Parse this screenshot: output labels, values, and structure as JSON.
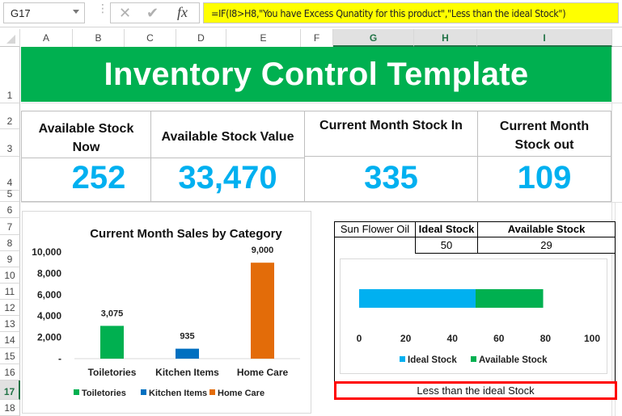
{
  "formula_bar": {
    "name_box": "G17",
    "cancel_icon": "x-icon",
    "enter_icon": "check-icon",
    "function_icon": "fx-icon",
    "formula": "=IF(I8>H8,\"You have Excess Qunatity for this product\",\"Less than the ideal Stock\")"
  },
  "columns": [
    "A",
    "B",
    "C",
    "D",
    "E",
    "F",
    "G",
    "H",
    "I"
  ],
  "selected_columns": [
    "G",
    "H",
    "I"
  ],
  "rows": [
    "1",
    "2",
    "3",
    "4",
    "5",
    "6",
    "7",
    "8",
    "9",
    "10",
    "11",
    "12",
    "13",
    "14",
    "15",
    "16",
    "17",
    "18"
  ],
  "selected_row": "17",
  "title": "Inventory Control Template",
  "colors": {
    "banner": "#00b050",
    "kpi_value": "#00b0f0",
    "toiletories": "#00b050",
    "kitchen_items": "#0070c0",
    "home_care": "#e36c09",
    "ideal_stock": "#00b0f0",
    "available_stock": "#00b050",
    "status_border": "#ff0000"
  },
  "kpis": [
    {
      "label_line1": "Available Stock",
      "label_line2": "Now",
      "value": "252"
    },
    {
      "label_line1": "Available Stock Value",
      "label_line2": "",
      "value": "33,470"
    },
    {
      "label_line1": "Current Month Stock In",
      "label_line2": "",
      "value": "335"
    },
    {
      "label_line1": "Current Month",
      "label_line2": "Stock out",
      "value": "109"
    }
  ],
  "stock_table": {
    "product": "Sun Flower Oil",
    "ideal_header": "Ideal Stock",
    "available_header": "Available Stock",
    "ideal_value": "50",
    "available_value": "29"
  },
  "status_text": "Less than the ideal Stock",
  "chart_data": [
    {
      "type": "bar",
      "title": "Current Month Sales by Category",
      "categories": [
        "Toiletories",
        "Kitchen Items",
        "Home Care"
      ],
      "values": [
        3075,
        935,
        9000
      ],
      "data_labels": [
        "3,075",
        "935",
        "9,000"
      ],
      "ylim": [
        0,
        10000
      ],
      "yticks": [
        0,
        2000,
        4000,
        6000,
        8000,
        10000
      ],
      "ytick_labels": [
        "-",
        "2,000",
        "4,000",
        "6,000",
        "8,000",
        "10,000"
      ],
      "xlabel": "",
      "ylabel": "",
      "grid": false,
      "legend": [
        "Toiletories",
        "Kitchen Items",
        "Home Care"
      ],
      "legend_position": "bottom"
    },
    {
      "type": "bar",
      "orientation": "horizontal",
      "stacked": true,
      "title": "",
      "categories": [
        "Sun Flower Oil"
      ],
      "series": [
        {
          "name": "Ideal Stock",
          "values": [
            50
          ]
        },
        {
          "name": "Available Stock",
          "values": [
            29
          ]
        }
      ],
      "xlim": [
        0,
        100
      ],
      "xticks": [
        0,
        20,
        40,
        60,
        80,
        100
      ],
      "xtick_labels": [
        "0",
        "20",
        "40",
        "60",
        "80",
        "100"
      ],
      "grid": false,
      "legend": [
        "Ideal Stock",
        "Available Stock"
      ],
      "legend_position": "bottom"
    }
  ]
}
